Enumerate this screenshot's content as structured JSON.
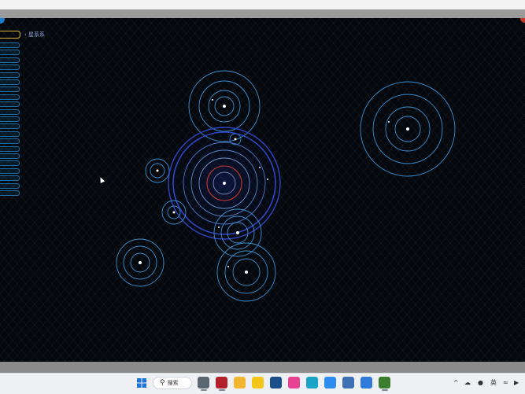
{
  "map": {
    "system_label": "‹ 星系系",
    "sidebar_tab_count": 21
  },
  "taskbar": {
    "search_label": "搜索",
    "ime_label": "英",
    "apps": [
      {
        "icon": "widgets-icon",
        "color": "#5b6673"
      },
      {
        "icon": "app-red-icon",
        "color": "#b3202a"
      },
      {
        "icon": "file-explorer-icon",
        "color": "#f2b632"
      },
      {
        "icon": "notes-icon",
        "color": "#f5c518"
      },
      {
        "icon": "calendar-app-icon",
        "color": "#1b4f8a"
      },
      {
        "icon": "paint-app-icon",
        "color": "#e84393"
      },
      {
        "icon": "edge-browser-icon",
        "color": "#1aa3c8"
      },
      {
        "icon": "mail-app-icon",
        "color": "#2d8cf0"
      },
      {
        "icon": "photos-app-icon",
        "color": "#3f6fb5"
      },
      {
        "icon": "maps-app-icon",
        "color": "#2f7bd9"
      },
      {
        "icon": "game-app-icon",
        "color": "#3b7d2e"
      }
    ]
  },
  "colors": {
    "map_background": "#05080d",
    "orbit_blue": "#3a8fd0",
    "orbit_selected": "#2f46c8",
    "selected_ring_red": "#c0392b",
    "accent_gold": "#d9b23a"
  }
}
